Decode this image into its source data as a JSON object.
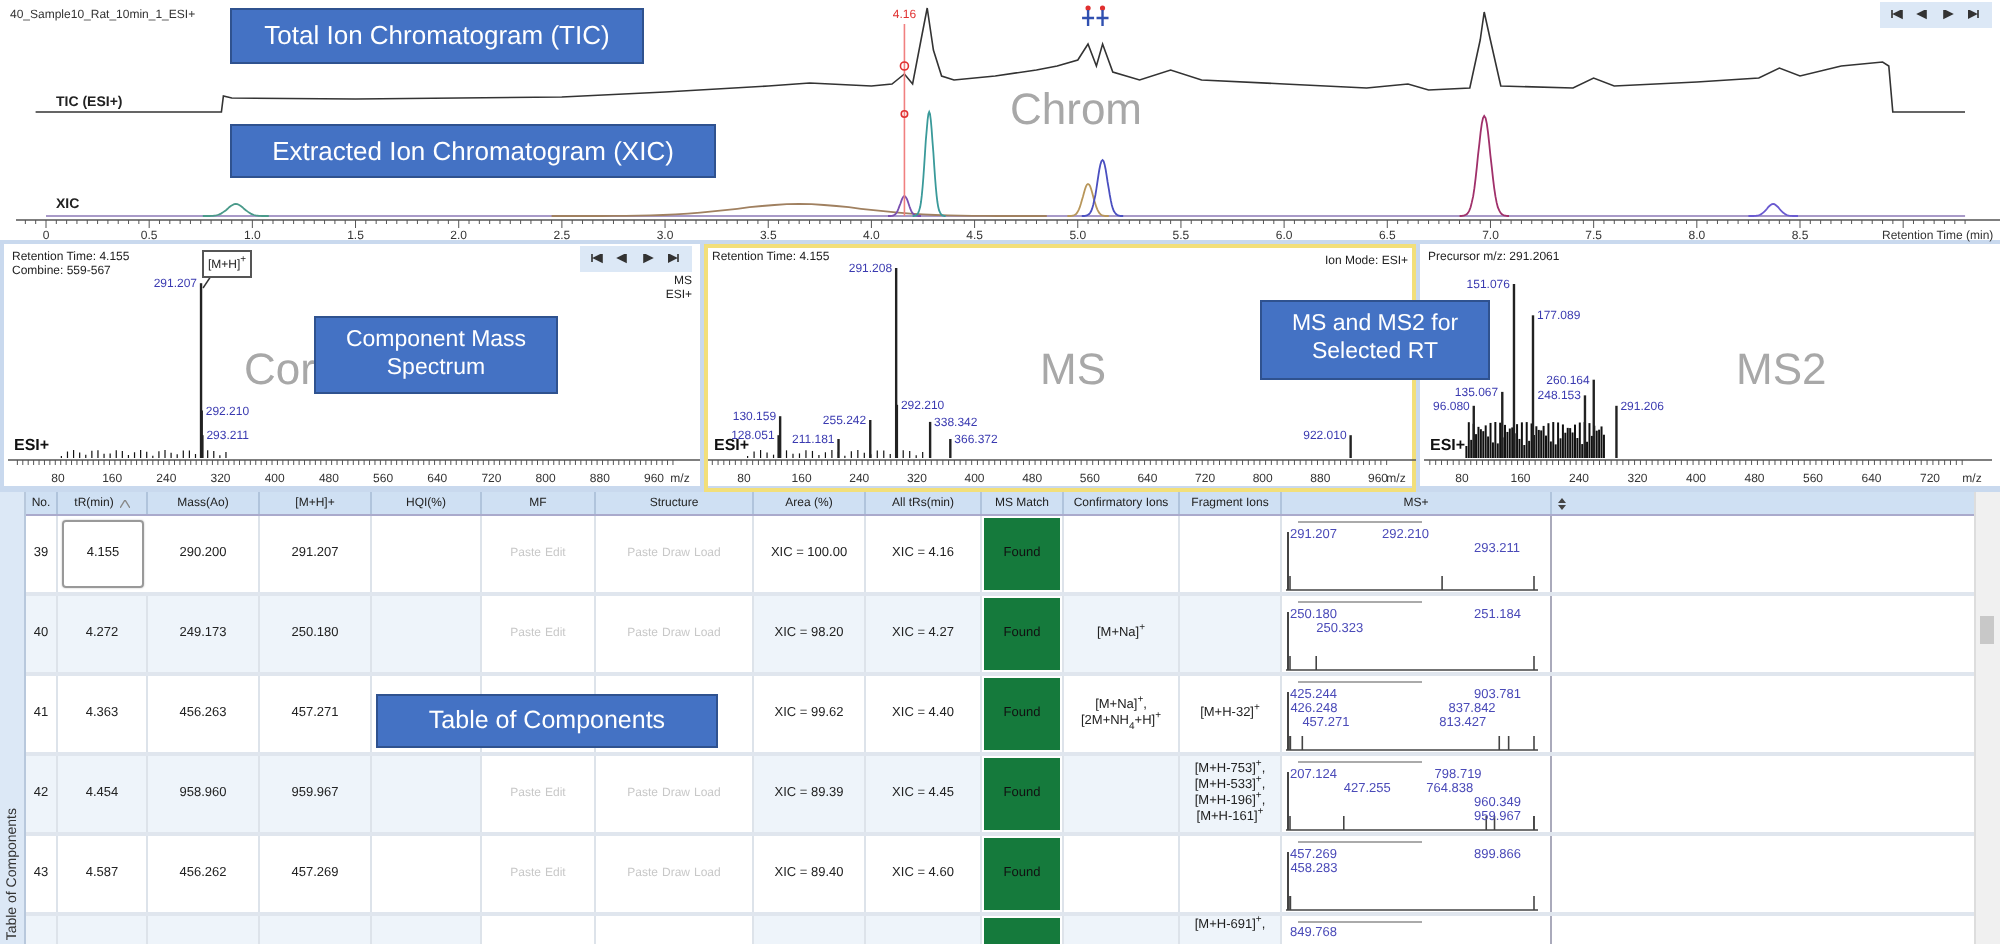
{
  "chromatogram": {
    "file_title": "40_Sample10_Rat_10min_1_ESI+",
    "panel_label": "Chrom",
    "traces": [
      {
        "label": "TIC (ESI+)",
        "kind": "tic"
      },
      {
        "label": "XIC",
        "kind": "xic"
      }
    ],
    "marker": "4.16",
    "x_ticks": [
      "0",
      "0.5",
      "1.0",
      "1.5",
      "2.0",
      "2.5",
      "3.0",
      "3.5",
      "4.0",
      "4.5",
      "5.0",
      "5.5",
      "6.0",
      "6.5",
      "7.0",
      "7.5",
      "8.0",
      "8.5"
    ],
    "x_label": "Retention Time (min)"
  },
  "spectra": [
    {
      "kind": "component",
      "selected": false,
      "info": [
        "Retention Time:  4.155",
        "Combine: 559-567"
      ],
      "panel_label": "Cor",
      "mode_labels": [
        "MS",
        "ESI+"
      ],
      "ion_label": "ESI+",
      "annotation": "[M+H]$^{+}$",
      "peaks": [
        "291.207",
        "292.210",
        "293.211"
      ],
      "x_ticks": [
        "80",
        "160",
        "240",
        "320",
        "400",
        "480",
        "560",
        "640",
        "720",
        "800",
        "880",
        "960"
      ],
      "x_label": "m/z"
    },
    {
      "kind": "ms",
      "info": [
        "Retention Time:  4.155"
      ],
      "ion_mode": "Ion Mode: ESI+",
      "panel_label": "MS",
      "ion_label": "ESI+",
      "selected": true,
      "peaks": [
        "291.208",
        "292.210",
        "130.159",
        "128.051",
        "211.181",
        "255.242",
        "338.342",
        "366.372",
        "922.010"
      ],
      "x_ticks": [
        "80",
        "160",
        "240",
        "320",
        "400",
        "480",
        "560",
        "640",
        "720",
        "800",
        "880",
        "960"
      ],
      "x_label": "m/z"
    },
    {
      "kind": "ms2",
      "selected": false,
      "info": [
        "Precursor m/z: 291.2061"
      ],
      "panel_label": "MS2",
      "ion_label": "ESI+",
      "peaks": [
        "151.076",
        "177.089",
        "260.164",
        "248.153",
        "135.067",
        "96.080",
        "291.206"
      ],
      "x_ticks": [
        "80",
        "160",
        "240",
        "320",
        "400",
        "480",
        "560",
        "640",
        "720"
      ],
      "x_label": "m/z"
    }
  ],
  "table": {
    "side_label": "Table of Components",
    "columns": [
      {
        "label": "No.",
        "sorted": false
      },
      {
        "label": "tR(min)",
        "sorted": true
      },
      {
        "label": "Mass(Ao)",
        "sorted": false
      },
      {
        "label": "[M+H]+",
        "sorted": false
      },
      {
        "label": "HQI(%)",
        "sorted": false
      },
      {
        "label": "MF",
        "sorted": false
      },
      {
        "label": "Structure",
        "sorted": false
      },
      {
        "label": "Area (%)",
        "sorted": false
      },
      {
        "label": "All tRs(min)",
        "sorted": false
      },
      {
        "label": "MS Match",
        "sorted": false
      },
      {
        "label": "Confirmatory Ions",
        "sorted": false
      },
      {
        "label": "Fragment Ions",
        "sorted": false
      },
      {
        "label": "MS+",
        "sorted": false
      }
    ],
    "rows": [
      {
        "kind": "component",
        "selected": true,
        "no": "39",
        "tr": "4.155",
        "mass": "290.200",
        "mh": "291.207",
        "mf": [
          "Paste",
          "Edit"
        ],
        "structure": [
          "Paste",
          "Draw",
          "Load"
        ],
        "actions_disabled": true,
        "area": "XIC = 100.00",
        "all_trs": "XIC = 4.16",
        "ms_match": "Found",
        "ms_peaks": [
          "291.207",
          "292.210",
          "293.211"
        ]
      },
      {
        "kind": "component",
        "selected": false,
        "no": "40",
        "tr": "4.272",
        "mass": "249.173",
        "mh": "250.180",
        "mf": [
          "Paste",
          "Edit"
        ],
        "structure": [
          "Paste",
          "Draw",
          "Load"
        ],
        "actions_disabled": true,
        "area": "XIC = 98.20",
        "all_trs": "XIC = 4.27",
        "ms_match": "Found",
        "confirmatory_ions": [
          "[M+Na]$^{+}$"
        ],
        "ms_peaks": [
          "250.180",
          "250.323",
          "251.184"
        ]
      },
      {
        "kind": "component",
        "selected": false,
        "no": "41",
        "tr": "4.363",
        "mass": "456.263",
        "mh": "457.271",
        "area": "XIC = 99.62",
        "all_trs": "XIC = 4.40",
        "ms_match": "Found",
        "confirmatory_ions": [
          "[M+Na]$^{+}$,",
          "[2M+NH$_{4}$+H]$^{+}$"
        ],
        "fragment_ions": [
          "[M+H-32]$^{+}$"
        ],
        "ms_peaks": [
          "425.244",
          "426.248",
          "457.271",
          "903.781",
          "837.842",
          "813.427"
        ]
      },
      {
        "kind": "component",
        "selected": false,
        "no": "42",
        "tr": "4.454",
        "mass": "958.960",
        "mh": "959.967",
        "mf": [
          "Paste",
          "Edit"
        ],
        "structure": [
          "Paste",
          "Draw",
          "Load"
        ],
        "actions_disabled": true,
        "area": "XIC = 89.39",
        "all_trs": "XIC = 4.45",
        "ms_match": "Found",
        "fragment_ions": [
          "[M+H-753]$^{+}$,",
          "[M+H-533]$^{+}$,",
          "[M+H-196]$^{+}$,",
          "[M+H-161]$^{+}$"
        ],
        "ms_peaks": [
          "207.124",
          "427.255",
          "798.719",
          "764.838",
          "960.349",
          "959.967"
        ]
      },
      {
        "kind": "component",
        "selected": false,
        "no": "43",
        "tr": "4.587",
        "mass": "456.262",
        "mh": "457.269",
        "mf": [
          "Paste",
          "Edit"
        ],
        "structure": [
          "Paste",
          "Draw",
          "Load"
        ],
        "actions_disabled": true,
        "area": "XIC = 89.40",
        "all_trs": "XIC = 4.60",
        "ms_match": "Found",
        "ms_peaks": [
          "457.269",
          "458.283",
          "899.866"
        ]
      },
      {
        "kind": "partial",
        "selected": false,
        "fragment_ions": [
          "[M+H-691]$^{+}$,"
        ],
        "ms_peaks": [
          "849.768"
        ]
      }
    ]
  },
  "callouts": [
    {
      "kind": "tic",
      "text": "Total Ion Chromatogram (TIC)"
    },
    {
      "kind": "xic",
      "text": "Extracted Ion Chromatogram (XIC)"
    },
    {
      "kind": "component",
      "text": "Component Mass Spectrum"
    },
    {
      "kind": "ms",
      "text": "MS and MS2 for Selected RT"
    },
    {
      "kind": "table",
      "text": "Table of Components"
    }
  ]
}
